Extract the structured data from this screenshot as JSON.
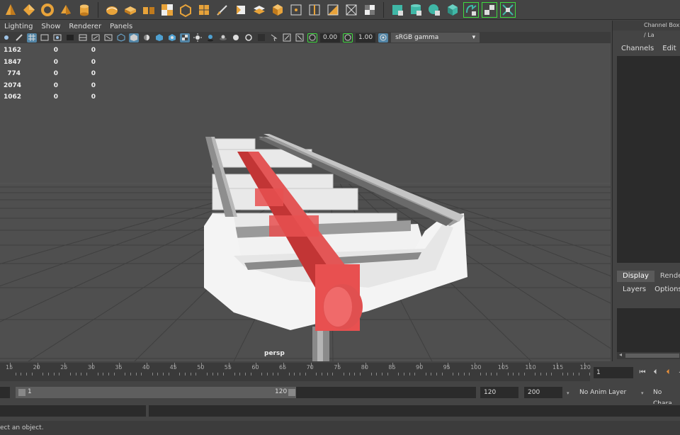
{
  "panel_menu": [
    "Lighting",
    "Show",
    "Renderer",
    "Panels"
  ],
  "toolbar": {
    "exposure_value": "0.00",
    "gamma_value": "1.00",
    "color_space": "sRGB gamma"
  },
  "hud": {
    "rows": [
      [
        "1162",
        "0",
        "0"
      ],
      [
        "1847",
        "0",
        "0"
      ],
      [
        "774",
        "0",
        "0"
      ],
      [
        "2074",
        "0",
        "0"
      ],
      [
        "1062",
        "0",
        "0"
      ]
    ]
  },
  "camera_label": "persp",
  "channel_box": {
    "title": "Channel Box / La",
    "menu": [
      "Channels",
      "Edit",
      "C"
    ]
  },
  "layer_editor": {
    "tabs": [
      "Display",
      "Render"
    ],
    "menu": [
      "Layers",
      "Options"
    ]
  },
  "time_slider": {
    "ticks": [
      "15",
      "20",
      "25",
      "30",
      "35",
      "40",
      "45",
      "50",
      "55",
      "60",
      "65",
      "70",
      "75",
      "80",
      "85",
      "90",
      "95",
      "100",
      "105",
      "110",
      "115",
      "120"
    ],
    "current_frame": "1"
  },
  "range_slider": {
    "start_label": "1",
    "end_label": "120",
    "anim_end": "120",
    "playback_end": "200",
    "anim_layer": "No Anim Layer",
    "character_set": "No Chara"
  },
  "help_line": "ect an object.",
  "colors": {
    "accent_teal": "#3fb7a6",
    "accent_orange": "#e8a33a",
    "selection_red": "#e85050"
  }
}
